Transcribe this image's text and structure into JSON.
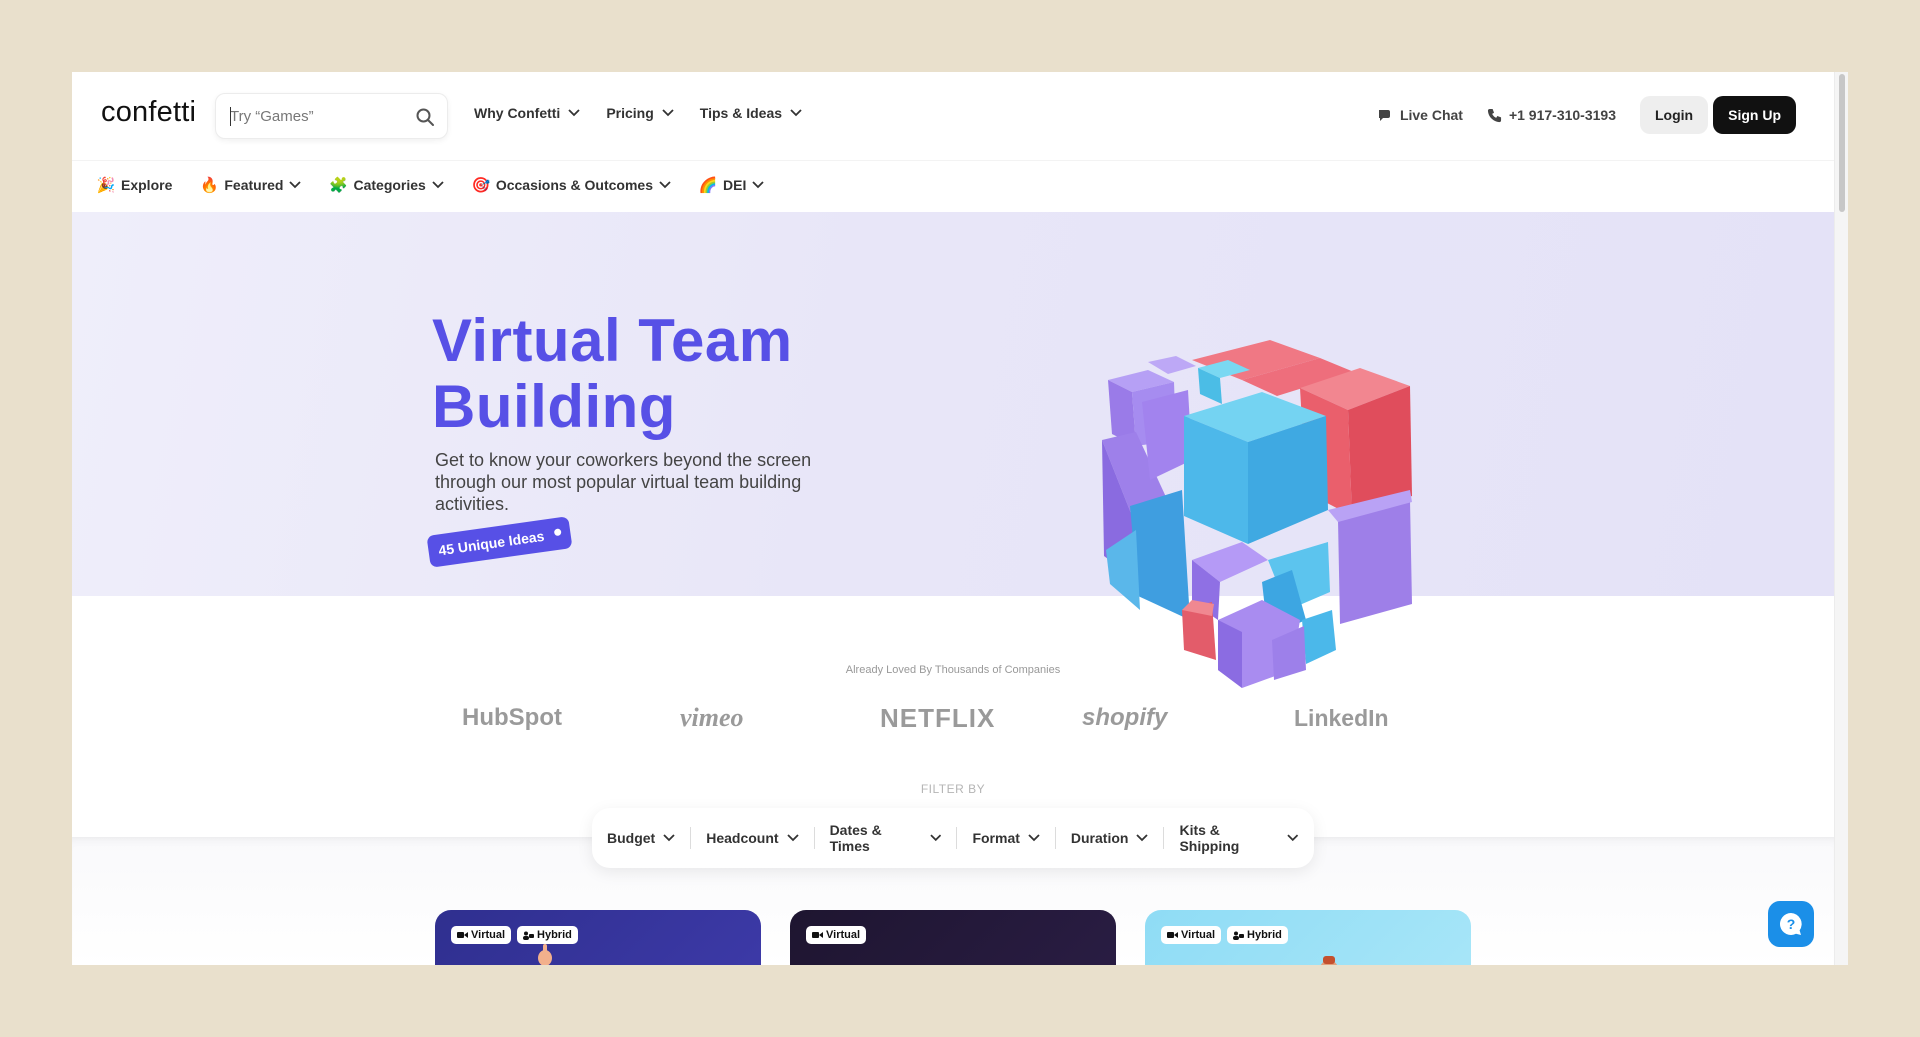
{
  "header": {
    "logo": "confetti",
    "search_placeholder": "Try “Games”",
    "nav": [
      {
        "label": "Why Confetti"
      },
      {
        "label": "Pricing"
      },
      {
        "label": "Tips & Ideas"
      }
    ],
    "live_chat": "Live Chat",
    "phone": "+1 917-310-3193",
    "login": "Login",
    "signup": "Sign Up"
  },
  "subnav": [
    {
      "label": "Explore",
      "icon": "🎉"
    },
    {
      "label": "Featured",
      "icon": "🔥"
    },
    {
      "label": "Categories",
      "icon": "🧩"
    },
    {
      "label": "Occasions & Outcomes",
      "icon": "🎯"
    },
    {
      "label": "DEI",
      "icon": "🌈"
    }
  ],
  "hero": {
    "title_line1": "Virtual Team",
    "title_line2": "Building",
    "subtitle": "Get to know your coworkers beyond the screen through our most popular virtual team building activities.",
    "badge": "45 Unique Ideas"
  },
  "companies": {
    "heading": "Already Loved By Thousands of Companies",
    "logos": [
      "HubSpot",
      "vimeo",
      "NETFLIX",
      "shopify",
      "LinkedIn"
    ]
  },
  "filters": {
    "heading": "FILTER BY",
    "items": [
      "Budget",
      "Headcount",
      "Dates & Times",
      "Format",
      "Duration",
      "Kits & Shipping"
    ]
  },
  "cards": [
    {
      "tags": [
        "Virtual",
        "Hybrid"
      ]
    },
    {
      "tags": [
        "Virtual"
      ]
    },
    {
      "tags": [
        "Virtual",
        "Hybrid"
      ]
    }
  ],
  "colors": {
    "accent": "#5750e6",
    "page_bg": "#e9e0cc",
    "hero_bg": "#e8e6f8",
    "help_button": "#1b8fe8"
  }
}
